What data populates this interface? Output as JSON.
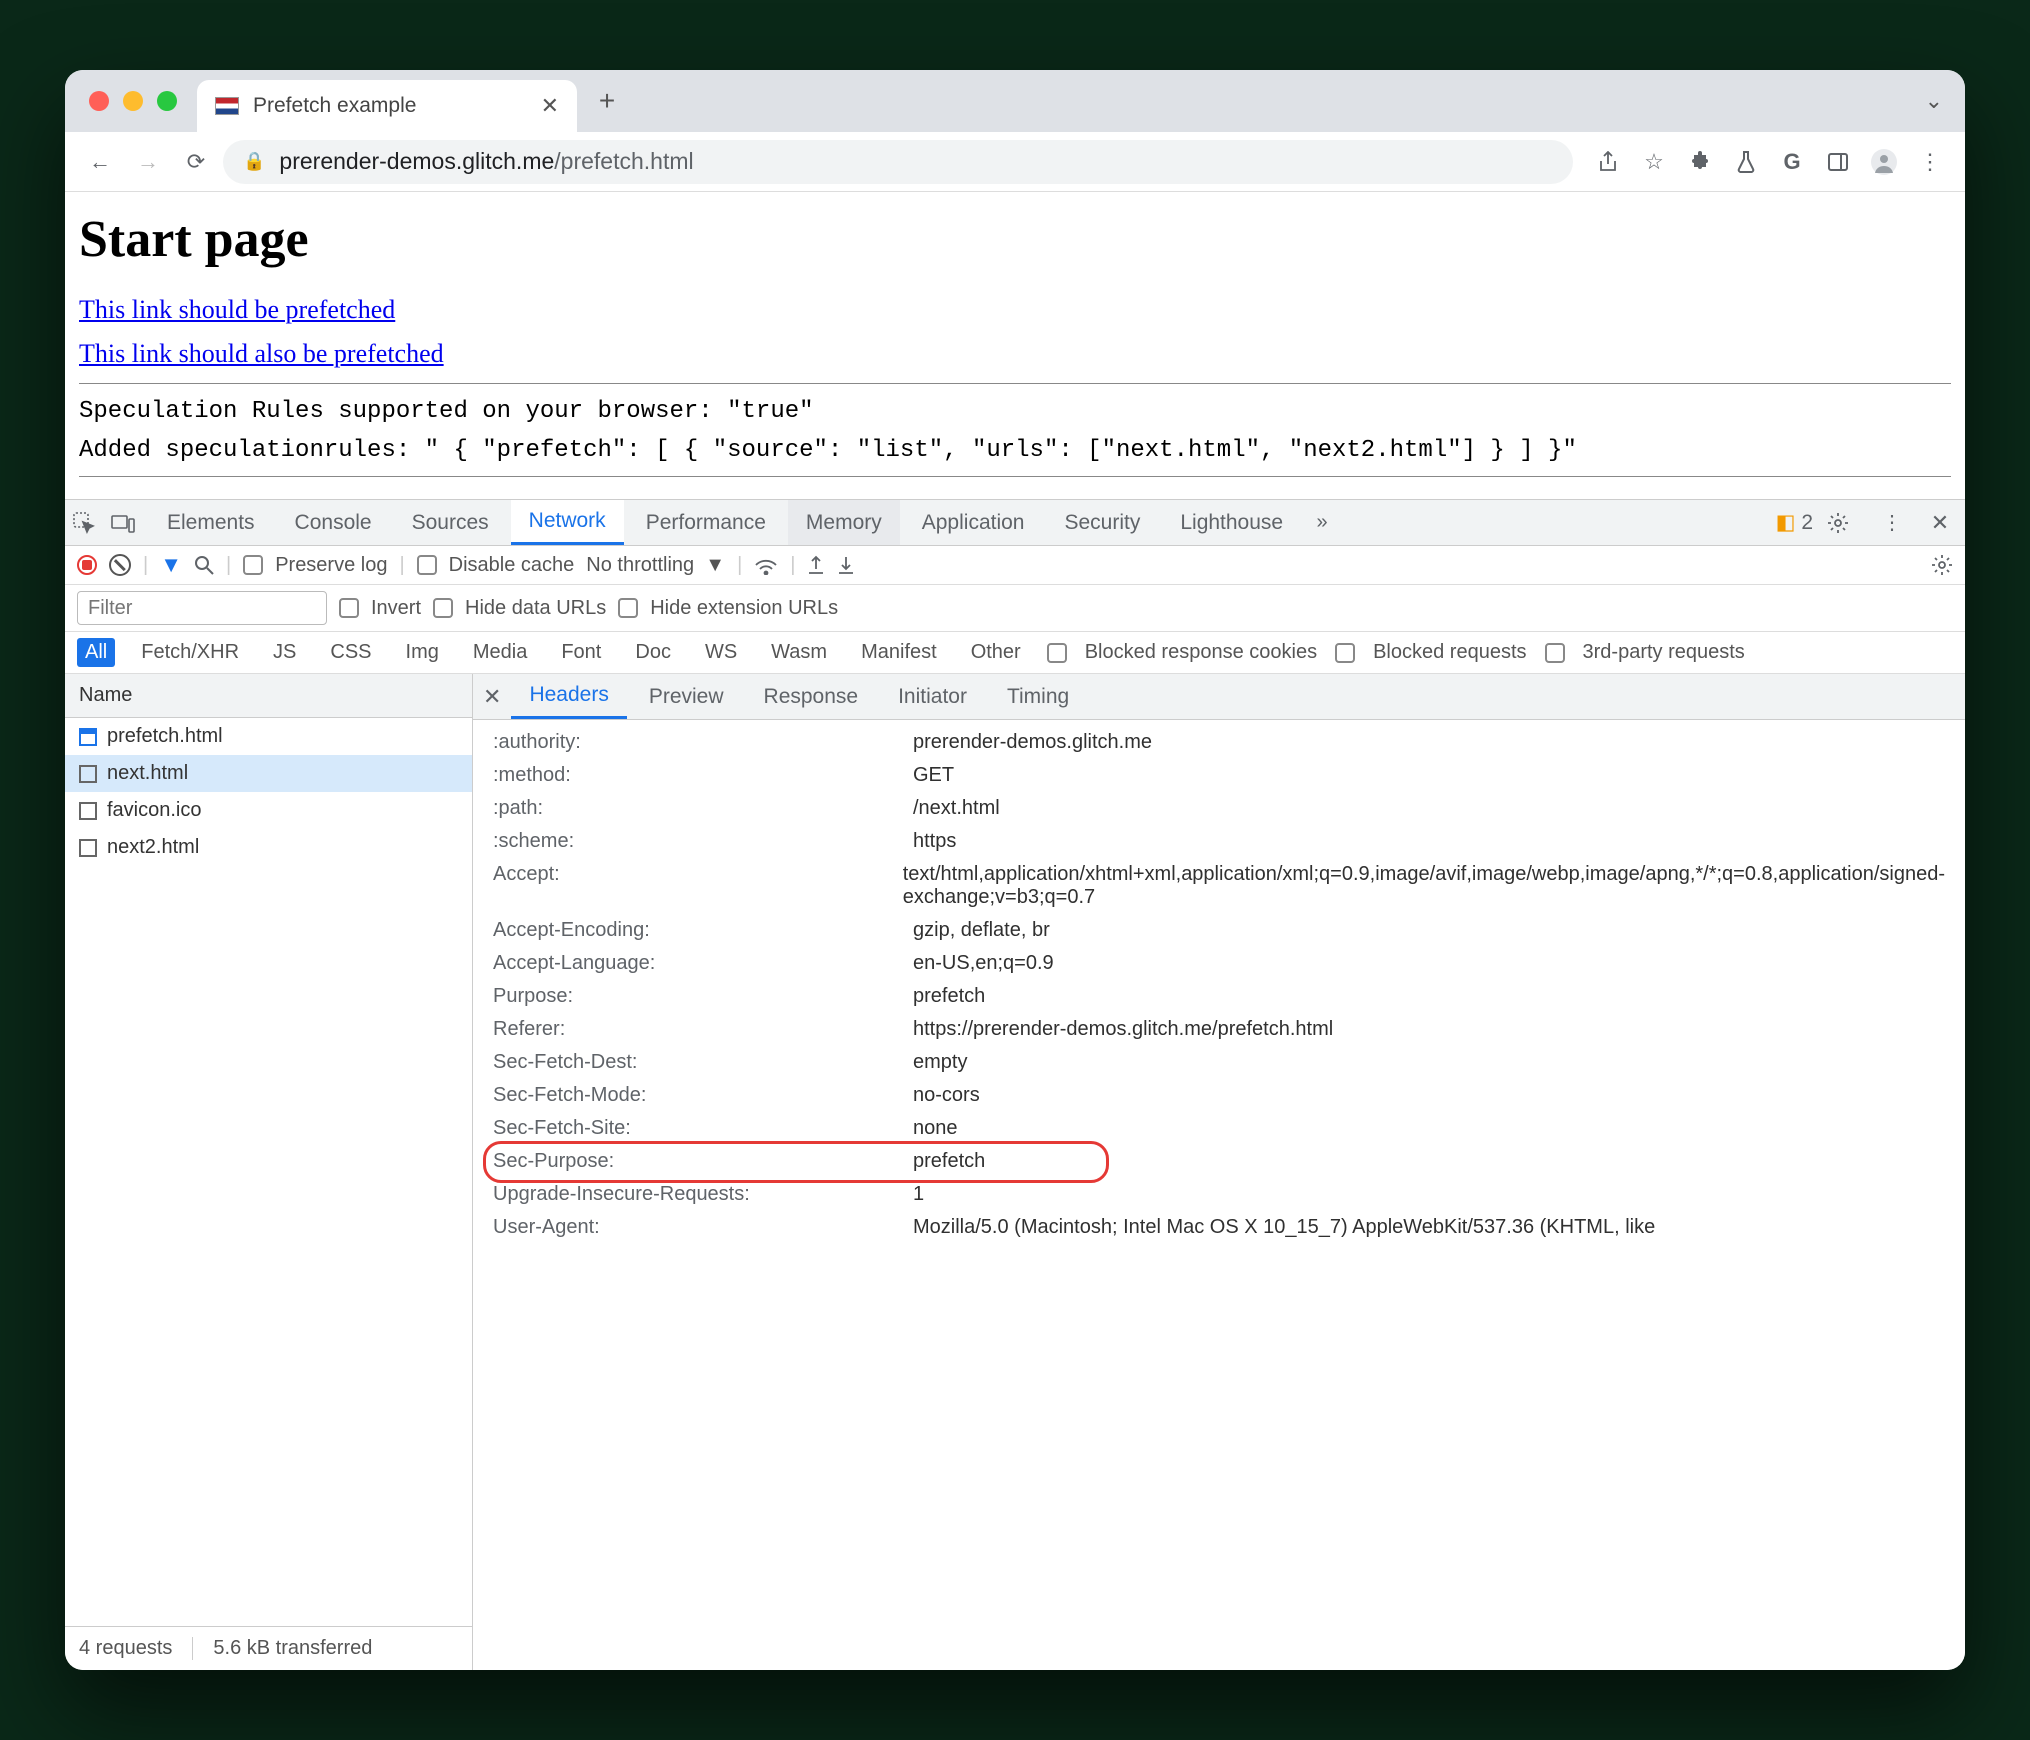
{
  "window": {
    "tab_title": "Prefetch example",
    "url_host": "prerender-demos.glitch.me",
    "url_path": "/prefetch.html"
  },
  "page": {
    "h1": "Start page",
    "link1": "This link should be prefetched",
    "link2": "This link should also be prefetched",
    "mono1": "Speculation Rules supported on your browser: \"true\"",
    "mono2": "Added speculationrules: \" { \"prefetch\": [ { \"source\": \"list\", \"urls\": [\"next.html\", \"next2.html\"] } ] }\""
  },
  "devtools": {
    "tabs": [
      "Elements",
      "Console",
      "Sources",
      "Network",
      "Performance",
      "Memory",
      "Application",
      "Security",
      "Lighthouse"
    ],
    "active_tab": "Network",
    "hover_tab": "Memory",
    "warn_count": "2",
    "net_toolbar": {
      "preserve": "Preserve log",
      "disable_cache": "Disable cache",
      "throttling": "No throttling"
    },
    "filter_row": {
      "placeholder": "Filter",
      "invert": "Invert",
      "hide_data": "Hide data URLs",
      "hide_ext": "Hide extension URLs"
    },
    "type_chips": [
      "All",
      "Fetch/XHR",
      "JS",
      "CSS",
      "Img",
      "Media",
      "Font",
      "Doc",
      "WS",
      "Wasm",
      "Manifest",
      "Other"
    ],
    "extra_filters": {
      "blocked_cookies": "Blocked response cookies",
      "blocked_req": "Blocked requests",
      "third_party": "3rd-party requests"
    },
    "requests_header": "Name",
    "requests": [
      {
        "name": "prefetch.html",
        "icon": "doc"
      },
      {
        "name": "next.html",
        "icon": "empty",
        "selected": true
      },
      {
        "name": "favicon.ico",
        "icon": "empty"
      },
      {
        "name": "next2.html",
        "icon": "empty"
      }
    ],
    "status": {
      "reqs": "4 requests",
      "xfer": "5.6 kB transferred"
    },
    "detail_tabs": [
      "Headers",
      "Preview",
      "Response",
      "Initiator",
      "Timing"
    ],
    "detail_active": "Headers",
    "headers": [
      {
        "n": ":authority:",
        "v": "prerender-demos.glitch.me"
      },
      {
        "n": ":method:",
        "v": "GET"
      },
      {
        "n": ":path:",
        "v": "/next.html"
      },
      {
        "n": ":scheme:",
        "v": "https"
      },
      {
        "n": "Accept:",
        "v": "text/html,application/xhtml+xml,application/xml;q=0.9,image/avif,image/webp,image/apng,*/*;q=0.8,application/signed-exchange;v=b3;q=0.7"
      },
      {
        "n": "Accept-Encoding:",
        "v": "gzip, deflate, br"
      },
      {
        "n": "Accept-Language:",
        "v": "en-US,en;q=0.9"
      },
      {
        "n": "Purpose:",
        "v": "prefetch"
      },
      {
        "n": "Referer:",
        "v": "https://prerender-demos.glitch.me/prefetch.html"
      },
      {
        "n": "Sec-Fetch-Dest:",
        "v": "empty"
      },
      {
        "n": "Sec-Fetch-Mode:",
        "v": "no-cors"
      },
      {
        "n": "Sec-Fetch-Site:",
        "v": "none"
      },
      {
        "n": "Sec-Purpose:",
        "v": "prefetch",
        "hl": true
      },
      {
        "n": "Upgrade-Insecure-Requests:",
        "v": "1"
      },
      {
        "n": "User-Agent:",
        "v": "Mozilla/5.0 (Macintosh; Intel Mac OS X 10_15_7) AppleWebKit/537.36 (KHTML, like"
      }
    ]
  }
}
